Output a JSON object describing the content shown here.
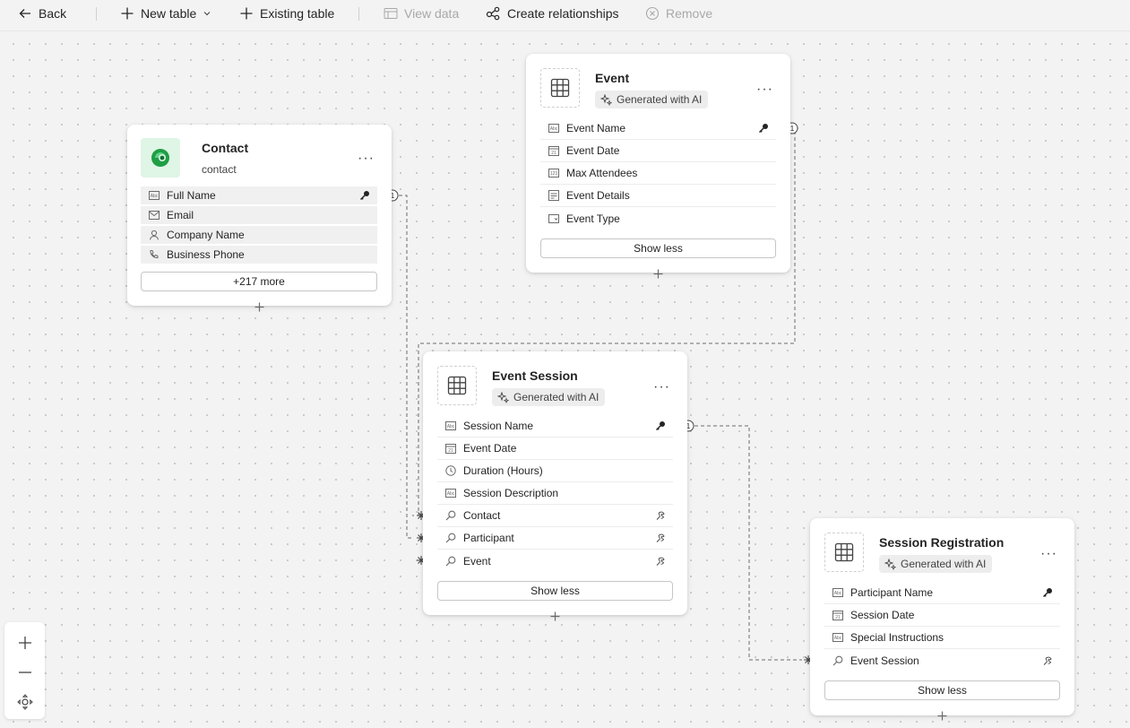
{
  "toolbar": {
    "back": "Back",
    "new_table": "New table",
    "existing_table": "Existing table",
    "view_data": "View data",
    "create_relationships": "Create relationships",
    "remove": "Remove"
  },
  "tables": {
    "contact": {
      "title": "Contact",
      "subtitle": "contact",
      "columns": [
        "Full Name",
        "Email",
        "Company Name",
        "Business Phone"
      ],
      "more_button": "+217 more"
    },
    "event": {
      "title": "Event",
      "badge": "Generated with AI",
      "columns": [
        "Event Name",
        "Event Date",
        "Max Attendees",
        "Event Details",
        "Event Type"
      ],
      "toggle_button": "Show less"
    },
    "event_session": {
      "title": "Event Session",
      "badge": "Generated with AI",
      "columns": [
        "Session Name",
        "Event Date",
        "Duration (Hours)",
        "Session Description",
        "Contact",
        "Participant",
        "Event"
      ],
      "toggle_button": "Show less"
    },
    "session_registration": {
      "title": "Session Registration",
      "badge": "Generated with AI",
      "columns": [
        "Participant Name",
        "Session Date",
        "Special Instructions",
        "Event Session"
      ],
      "toggle_button": "Show less"
    }
  },
  "relationship_markers": {
    "one": "1"
  },
  "icons": [
    "back-arrow-icon",
    "plus-icon",
    "chevron-down-icon",
    "view-data-icon",
    "relationships-icon",
    "remove-icon",
    "table-grid-icon",
    "ai-sparkle-icon",
    "more-icon",
    "text-field-icon",
    "email-icon",
    "person-icon",
    "phone-icon",
    "calendar-icon",
    "number-icon",
    "choice-icon",
    "clock-icon",
    "lookup-icon",
    "key-icon",
    "relationship-icon",
    "zoom-in-icon",
    "zoom-out-icon",
    "fit-view-icon"
  ],
  "colors": {
    "canvas": "#f3f3f3",
    "card": "#ffffff",
    "contact_logo_bg": "#dff5e6",
    "contact_logo": "#1f9e45"
  }
}
